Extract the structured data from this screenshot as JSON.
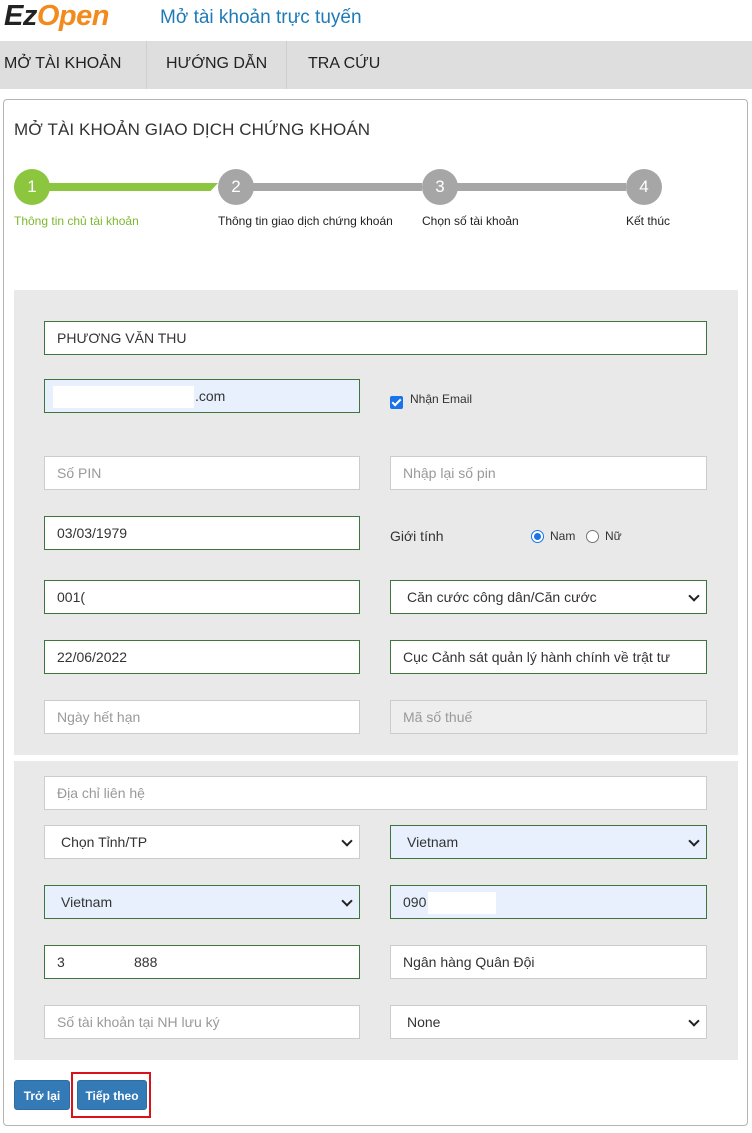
{
  "header": {
    "logo_ez": "Ez",
    "logo_open": "Open",
    "tagline": "Mở tài khoản trực tuyến"
  },
  "nav": {
    "items": [
      {
        "label": "MỞ TÀI KHOẢN"
      },
      {
        "label": "HƯỚNG DẪN"
      },
      {
        "label": "TRA CỨU"
      }
    ]
  },
  "panel": {
    "title": "MỞ TÀI KHOẢN GIAO DỊCH CHỨNG KHOÁN"
  },
  "steps": [
    {
      "number": "1",
      "label": "Thông tin chủ tài khoản",
      "active": true
    },
    {
      "number": "2",
      "label": "Thông tin giao dịch chứng khoán",
      "active": false
    },
    {
      "number": "3",
      "label": "Chọn số tài khoản",
      "active": false
    },
    {
      "number": "4",
      "label": "Kết thúc",
      "active": false
    }
  ],
  "form": {
    "full_name": "PHƯƠNG VĂN THU",
    "email_suffix": ".com",
    "receive_email_label": "Nhận Email",
    "receive_email_checked": true,
    "pin_placeholder": "Số PIN",
    "pin_confirm_placeholder": "Nhập lại số pin",
    "birth_date": "03/03/1979",
    "gender_label": "Giới tính",
    "gender_male": "Nam",
    "gender_female": "Nữ",
    "gender_selected": "Nam",
    "id_number": "001(",
    "id_type": "Căn cước công dân/Căn cước",
    "issue_date": "22/06/2022",
    "issue_place": "Cục Cảnh sát quản lý hành chính về trật tư",
    "expiry_placeholder": "Ngày hết hạn",
    "tax_code_placeholder": "Mã số thuế",
    "address_placeholder": "Địa chỉ liên hệ",
    "province": "Chọn Tỉnh/TP",
    "country": "Vietnam",
    "nationality": "Vietnam",
    "phone_prefix": "090",
    "bank_account_start": "3",
    "bank_account_end": "888",
    "bank_name": "Ngân hàng Quân Đội",
    "custody_account_placeholder": "Số tài khoản tại NH lưu ký",
    "custody_bank": "None"
  },
  "buttons": {
    "back": "Trở lại",
    "next": "Tiếp theo"
  },
  "colors": {
    "accent_green": "#8cc63f",
    "step_gray": "#a6a6a6",
    "primary_blue": "#337ab7",
    "highlight_red": "#d9131b",
    "logo_orange": "#f28a1c"
  }
}
